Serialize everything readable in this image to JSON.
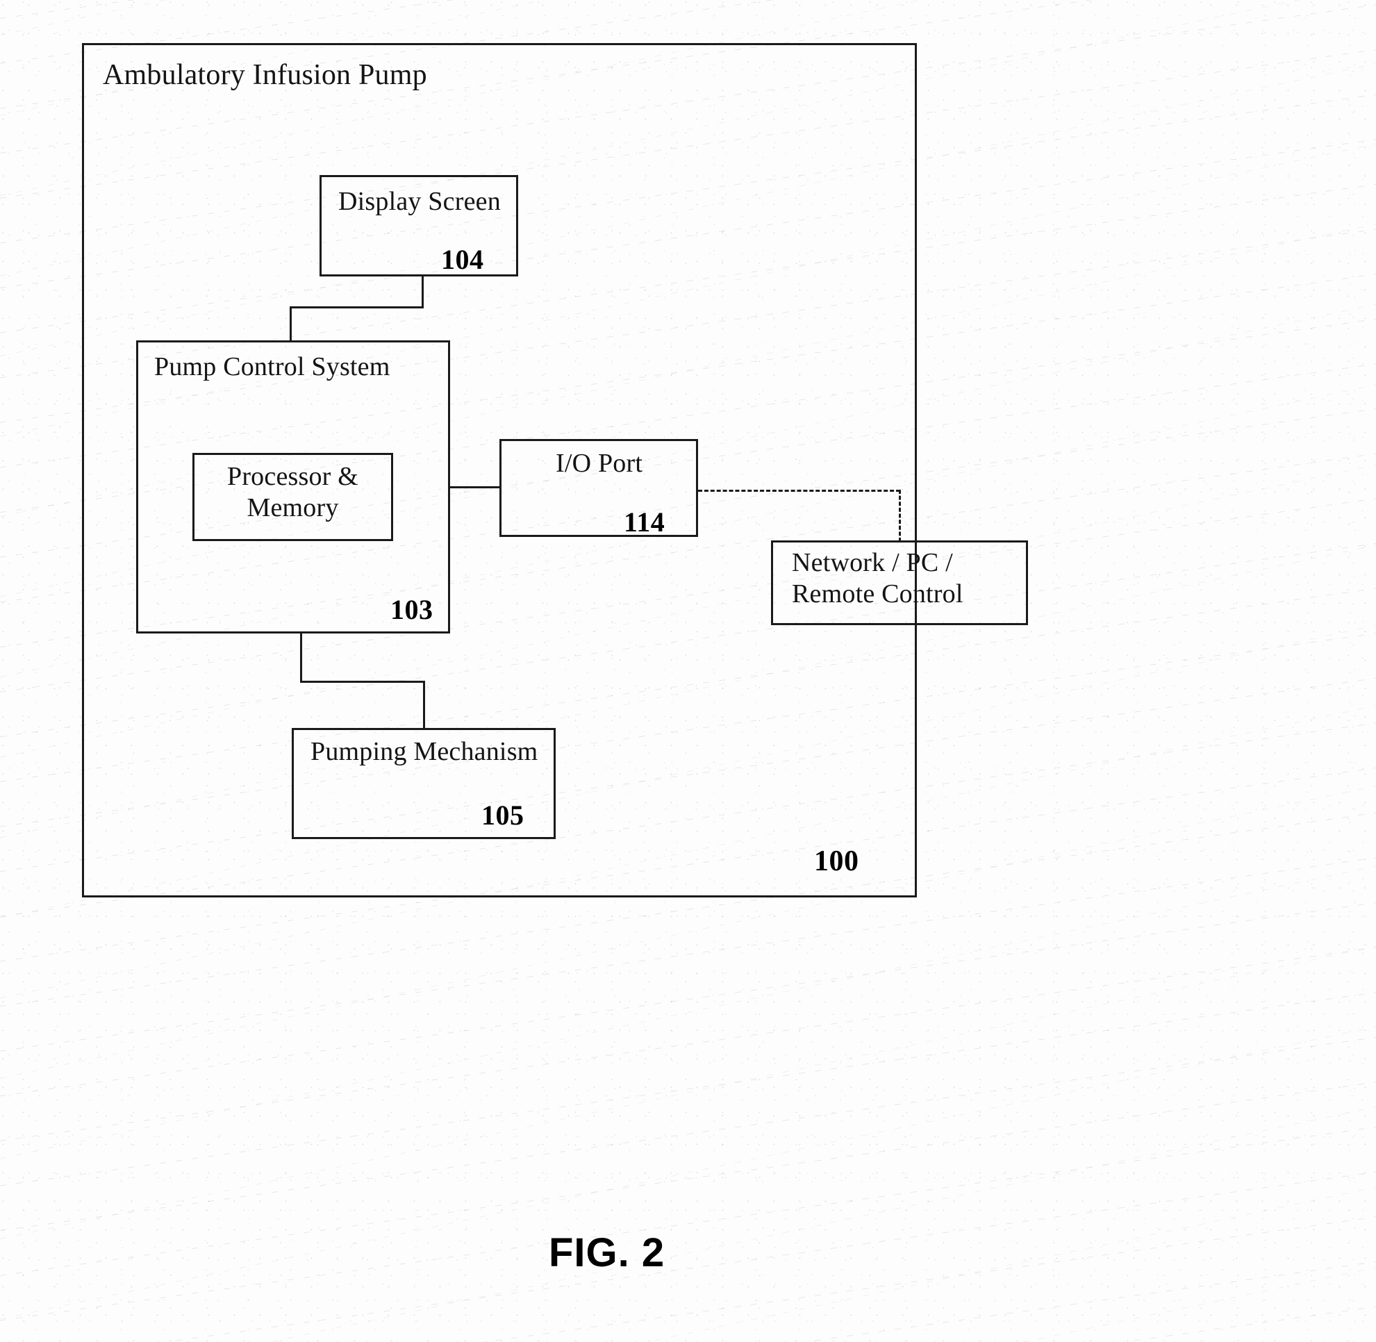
{
  "figure": {
    "caption": "FIG. 2",
    "title": "Ambulatory Infusion Pump"
  },
  "outer_box": {
    "label": "Ambulatory Infusion Pump",
    "ref": "100"
  },
  "blocks": [
    {
      "key": "display_screen",
      "label": "Display Screen",
      "ref": "104"
    },
    {
      "key": "pump_control",
      "label": "Pump Control System",
      "ref": "103"
    },
    {
      "key": "processor_memory",
      "label": "Processor &\nMemory",
      "ref": ""
    },
    {
      "key": "io_port",
      "label": "I/O Port",
      "ref": "114"
    },
    {
      "key": "pumping_mech",
      "label": "Pumping Mechanism",
      "ref": "105"
    },
    {
      "key": "network_pc",
      "label": "Network / PC /\nRemote Control",
      "ref": ""
    }
  ],
  "display_screen": {
    "label": "Display Screen",
    "ref": "104"
  },
  "pump_control": {
    "label": "Pump Control System",
    "ref": "103"
  },
  "processor_memory": {
    "label": "Processor &\nMemory",
    "ref": ""
  },
  "io_port": {
    "label": "I/O Port",
    "ref": "114"
  },
  "pumping_mech": {
    "label": "Pumping Mechanism",
    "ref": "105"
  },
  "network_pc": {
    "label": "Network / PC /\nRemote Control",
    "ref": ""
  },
  "connections": [
    {
      "from": "pump_control",
      "to": "display_screen",
      "style": "solid"
    },
    {
      "from": "pump_control",
      "to": "io_port",
      "style": "solid"
    },
    {
      "from": "pump_control",
      "to": "pumping_mech",
      "style": "solid"
    },
    {
      "from": "io_port",
      "to": "network_pc",
      "style": "dashed"
    }
  ],
  "colors": {
    "ink": "#1a1a1a",
    "paper": "#fdfdfd"
  }
}
